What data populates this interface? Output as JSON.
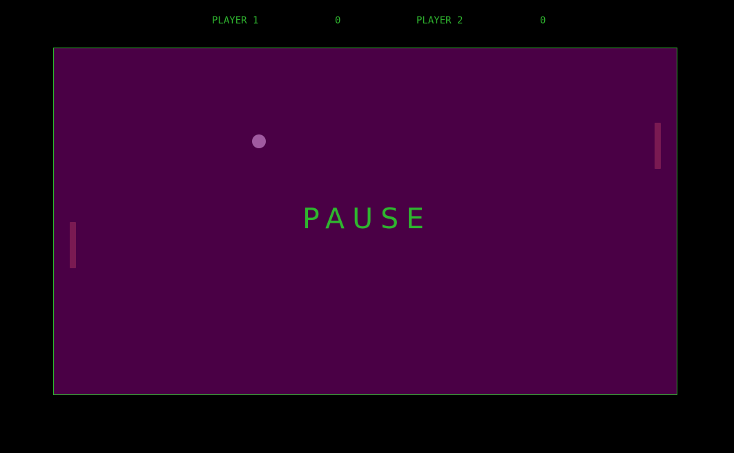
{
  "colors": {
    "background": "#000000",
    "court": "#4a0045",
    "border": "#2fb62f",
    "text": "#2fb62f",
    "paddle": "#7a1a52",
    "ball": "#a05aa0"
  },
  "scoreboard": {
    "player1_label": "PLAYER 1",
    "player1_score": "0",
    "player2_label": "PLAYER 2",
    "player2_score": "0"
  },
  "game": {
    "status": "PAUSE"
  }
}
